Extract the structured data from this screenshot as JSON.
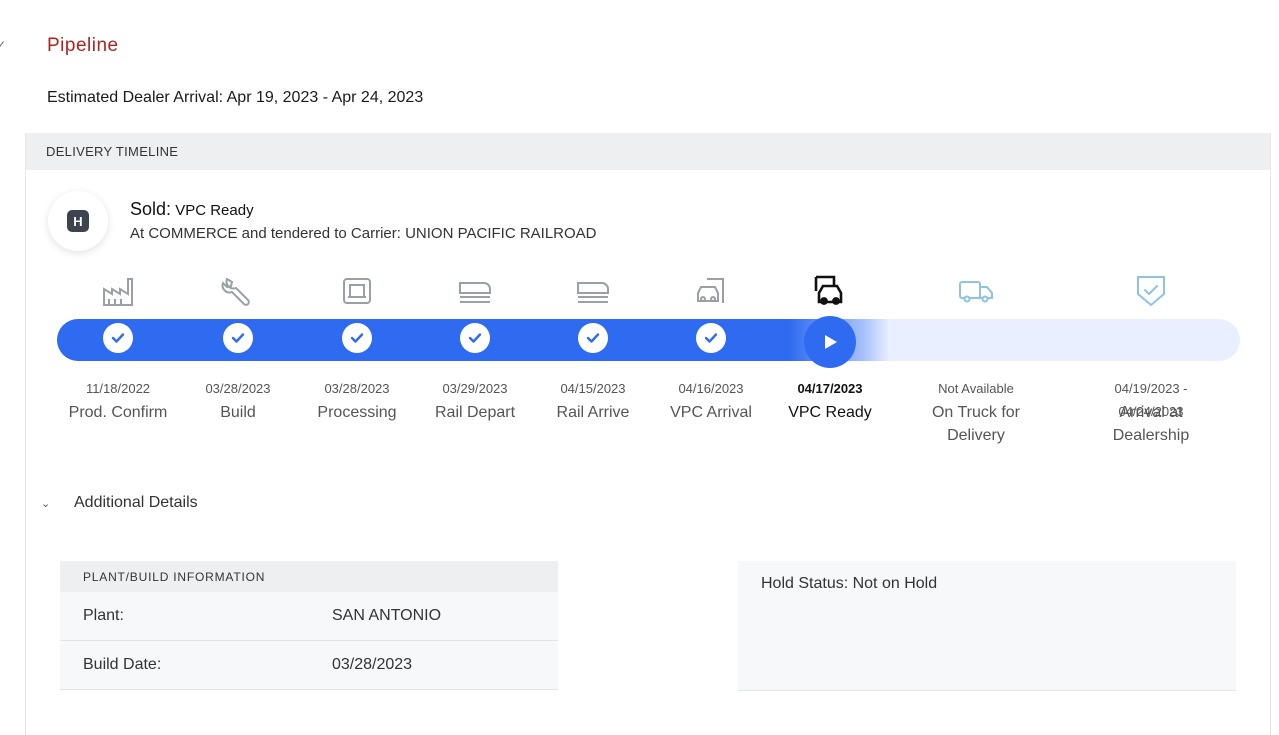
{
  "header": {
    "title": "Pipeline",
    "eta": "Estimated Dealer Arrival: Apr 19, 2023 - Apr 24, 2023"
  },
  "timeline": {
    "section_label": "DELIVERY TIMELINE",
    "status_badge": "H",
    "status_label": "Sold:",
    "status_value": "VPC Ready",
    "status_detail": "At COMMERCE and tendered to Carrier: UNION PACIFIC RAILROAD",
    "progress_fraction": 0.7,
    "accent": "#2f6bf0",
    "track_color": "#e9efff",
    "stages": [
      {
        "icon": "factory-icon",
        "date": "11/18/2022",
        "name": "Prod. Confirm",
        "state": "done"
      },
      {
        "icon": "wrench-icon",
        "date": "03/28/2023",
        "name": "Build",
        "state": "done"
      },
      {
        "icon": "car-seat-icon",
        "date": "03/28/2023",
        "name": "Processing",
        "state": "done"
      },
      {
        "icon": "train-icon",
        "date": "03/29/2023",
        "name": "Rail Depart",
        "state": "done"
      },
      {
        "icon": "train-icon",
        "date": "04/15/2023",
        "name": "Rail Arrive",
        "state": "done"
      },
      {
        "icon": "vehicle-port-icon",
        "date": "04/16/2023",
        "name": "VPC Arrival",
        "state": "done"
      },
      {
        "icon": "vehicle-port-icon",
        "date": "04/17/2023",
        "name": "VPC Ready",
        "state": "current"
      },
      {
        "icon": "truck-icon",
        "date": "Not Available",
        "name": "On Truck for Delivery",
        "state": "pending"
      },
      {
        "icon": "shield-check-icon",
        "date": "04/19/2023 - 04/24/2023",
        "name": "Arrival at Dealership",
        "state": "pending"
      }
    ]
  },
  "additional_details": {
    "toggle_label": "Additional Details",
    "plant_section": {
      "title": "PLANT/BUILD INFORMATION",
      "rows": [
        {
          "label": "Plant:",
          "value": "SAN ANTONIO"
        },
        {
          "label": "Build Date:",
          "value": "03/28/2023"
        }
      ]
    },
    "hold_status": "Hold Status: Not on Hold"
  }
}
